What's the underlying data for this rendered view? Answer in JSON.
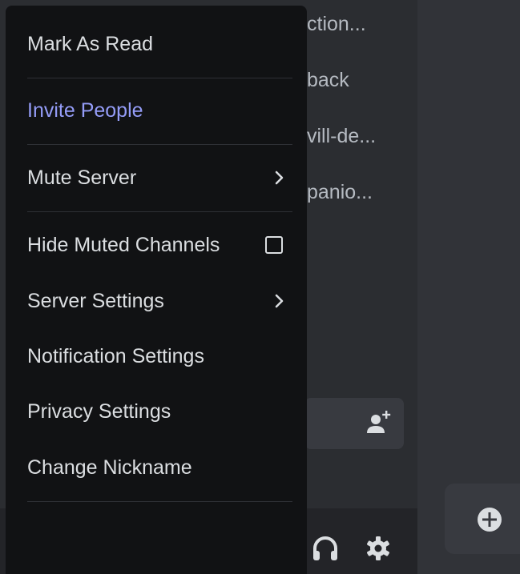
{
  "background": {
    "channels": [
      "ction...",
      "back",
      "vill-de...",
      "panio..."
    ]
  },
  "menu": {
    "items": [
      {
        "label": "Mark As Read",
        "color": "#dbdee1"
      },
      {
        "label": "Invite People",
        "color": "#949cf7"
      },
      {
        "label": "Mute Server",
        "color": "#dbdee1",
        "trailing": "chevron-right-icon"
      },
      {
        "label": "Hide Muted Channels",
        "color": "#dbdee1",
        "trailing": "checkbox",
        "checked": false
      },
      {
        "label": "Server Settings",
        "color": "#dbdee1",
        "trailing": "chevron-right-icon"
      },
      {
        "label": "Notification Settings",
        "color": "#dbdee1"
      },
      {
        "label": "Privacy Settings",
        "color": "#dbdee1"
      },
      {
        "label": "Change Nickname",
        "color": "#dbdee1"
      }
    ]
  },
  "icons": {
    "invite": "add-user-icon",
    "headset": "headphones-icon",
    "settings": "gear-icon",
    "add": "plus-circle-icon"
  },
  "colors": {
    "menu_bg": "#111214",
    "channel_bg": "#2b2d31",
    "accent": "#949cf7",
    "text": "#dbdee1"
  }
}
